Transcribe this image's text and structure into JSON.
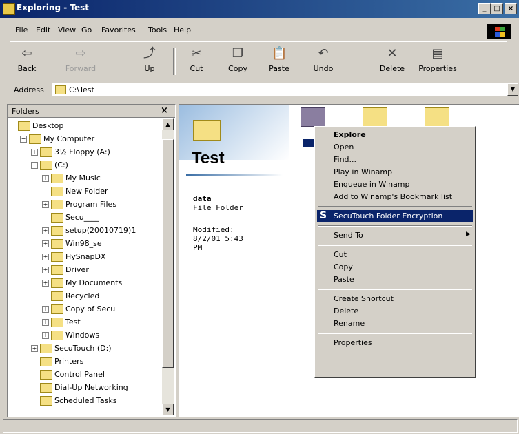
{
  "window": {
    "title": "Exploring - Test",
    "min": "_",
    "max": "□",
    "close": "×"
  },
  "menu": [
    "File",
    "Edit",
    "View",
    "Go",
    "Favorites",
    "Tools",
    "Help"
  ],
  "toolbar": [
    {
      "label": "Back",
      "icon": "⇦",
      "disabled": false
    },
    {
      "label": "Forward",
      "icon": "⇨",
      "disabled": true
    },
    {
      "label": "Up",
      "icon": "⤴",
      "disabled": false
    },
    {
      "label": "Cut",
      "icon": "✂",
      "disabled": false
    },
    {
      "label": "Copy",
      "icon": "❐",
      "disabled": false
    },
    {
      "label": "Paste",
      "icon": "📋",
      "disabled": false
    },
    {
      "label": "Undo",
      "icon": "↶",
      "disabled": false
    },
    {
      "label": "Delete",
      "icon": "✕",
      "disabled": false
    },
    {
      "label": "Properties",
      "icon": "▤",
      "disabled": false
    }
  ],
  "address": {
    "label": "Address",
    "value": "C:\\Test"
  },
  "folders_pane": {
    "title": "Folders",
    "close": "×",
    "items": [
      {
        "label": "Desktop",
        "depth": 0,
        "expander": ""
      },
      {
        "label": "My Computer",
        "depth": 1,
        "expander": "−"
      },
      {
        "label": "3½ Floppy (A:)",
        "depth": 2,
        "expander": "+"
      },
      {
        "label": "(C:)",
        "depth": 2,
        "expander": "−"
      },
      {
        "label": "My Music",
        "depth": 3,
        "expander": "+"
      },
      {
        "label": "New Folder",
        "depth": 3,
        "expander": ""
      },
      {
        "label": "Program Files",
        "depth": 3,
        "expander": "+"
      },
      {
        "label": "Secu____",
        "depth": 3,
        "expander": ""
      },
      {
        "label": "setup(20010719)1",
        "depth": 3,
        "expander": "+"
      },
      {
        "label": "Win98_se",
        "depth": 3,
        "expander": "+"
      },
      {
        "label": "HySnapDX",
        "depth": 3,
        "expander": "+"
      },
      {
        "label": "Driver",
        "depth": 3,
        "expander": "+"
      },
      {
        "label": "My Documents",
        "depth": 3,
        "expander": "+"
      },
      {
        "label": "Recycled",
        "depth": 3,
        "expander": ""
      },
      {
        "label": "Copy of Secu",
        "depth": 3,
        "expander": "+"
      },
      {
        "label": "Test",
        "depth": 3,
        "expander": "+"
      },
      {
        "label": "Windows",
        "depth": 3,
        "expander": "+"
      },
      {
        "label": "SecuTouch (D:)",
        "depth": 2,
        "expander": "+"
      },
      {
        "label": "Printers",
        "depth": 2,
        "expander": ""
      },
      {
        "label": "Control Panel",
        "depth": 2,
        "expander": ""
      },
      {
        "label": "Dial-Up Networking",
        "depth": 2,
        "expander": ""
      },
      {
        "label": "Scheduled Tasks",
        "depth": 2,
        "expander": ""
      }
    ]
  },
  "content": {
    "folder_title": "Test",
    "selected_name": "data",
    "selected_type": "File Folder",
    "modified_label": "Modified:",
    "modified_date": "8/2/01 5:43",
    "modified_time": "PM"
  },
  "context_menu": [
    {
      "label": "Explore",
      "bold": true
    },
    {
      "label": "Open"
    },
    {
      "label": "Find..."
    },
    {
      "label": "Play in Winamp"
    },
    {
      "label": "Enqueue in Winamp"
    },
    {
      "label": "Add to Winamp's Bookmark list"
    },
    {
      "sep": true
    },
    {
      "label": "SecuTouch Folder Encryption",
      "selected": true,
      "icon": "S"
    },
    {
      "sep": true
    },
    {
      "label": "Send To",
      "arrow": "▶"
    },
    {
      "sep": true
    },
    {
      "label": "Cut"
    },
    {
      "label": "Copy"
    },
    {
      "label": "Paste"
    },
    {
      "sep": true
    },
    {
      "label": "Create Shortcut"
    },
    {
      "label": "Delete"
    },
    {
      "label": "Rename"
    },
    {
      "sep": true
    },
    {
      "label": "Properties"
    }
  ],
  "colors": {
    "titlebar": "#0a246a",
    "selection": "#0a246a",
    "folder": "#f5e084"
  }
}
